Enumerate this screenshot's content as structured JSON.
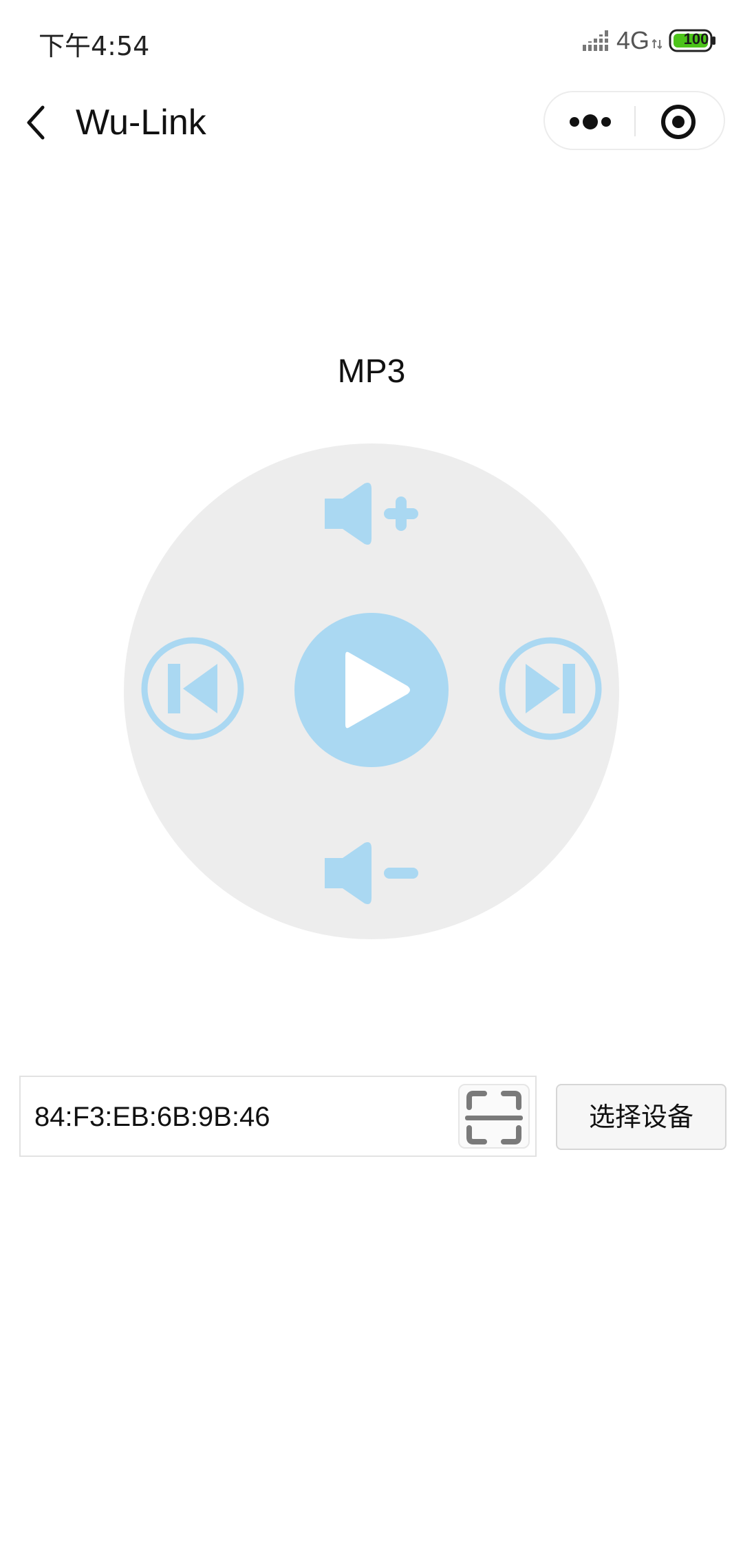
{
  "status_bar": {
    "time": "下午4:54",
    "network": "4G",
    "battery": "100",
    "signal_icon": "signal-icon",
    "battery_color": "#4cc31a"
  },
  "nav": {
    "title": "Wu-Link",
    "back_icon": "chevron-left-icon",
    "more_icon": "more-dots-icon",
    "close_icon": "target-circle-icon"
  },
  "player": {
    "title": "MP3",
    "accent_color": "#aad8f2",
    "disc_color": "#ededed",
    "controls": {
      "volume_up": "volume-up-icon",
      "volume_down": "volume-down-icon",
      "previous": "skip-previous-icon",
      "play": "play-icon",
      "next": "skip-next-icon"
    }
  },
  "device": {
    "mac_value": "84:F3:EB:6B:9B:46",
    "scan_icon": "scan-icon",
    "select_label": "选择设备"
  }
}
